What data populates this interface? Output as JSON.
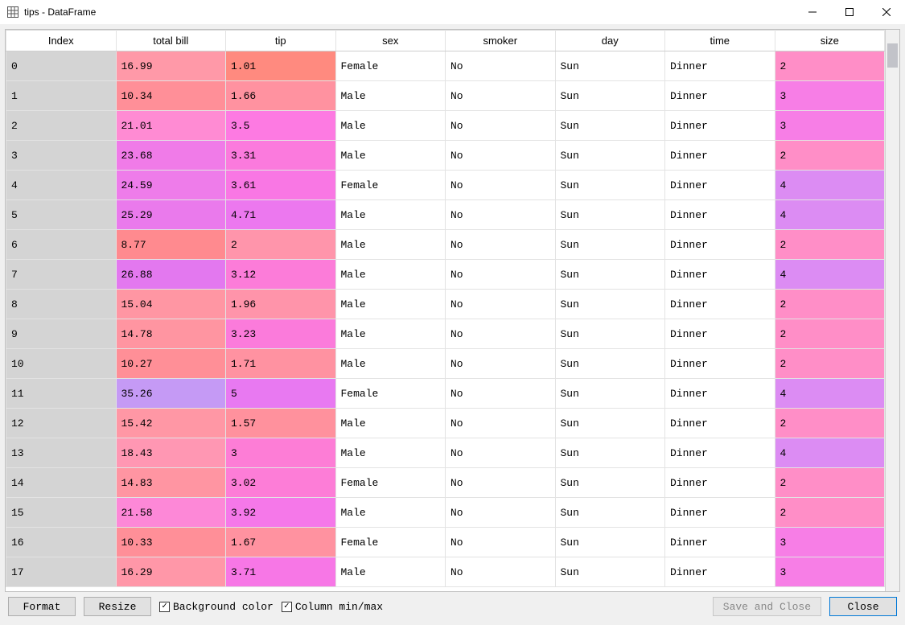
{
  "window": {
    "title": "tips - DataFrame"
  },
  "table": {
    "headers": [
      "Index",
      "total bill",
      "tip",
      "sex",
      "smoker",
      "day",
      "time",
      "size"
    ],
    "rows": [
      {
        "idx": "0",
        "total_bill": "16.99",
        "tip": "1.01",
        "sex": "Female",
        "smoker": "No",
        "day": "Sun",
        "time": "Dinner",
        "size": "2",
        "c_tb": "#ff99a8",
        "c_tip": "#ff8a7f",
        "c_size": "#ff8ec7"
      },
      {
        "idx": "1",
        "total_bill": "10.34",
        "tip": "1.66",
        "sex": "Male",
        "smoker": "No",
        "day": "Sun",
        "time": "Dinner",
        "size": "3",
        "c_tb": "#ff8f98",
        "c_tip": "#ff92a0",
        "c_size": "#f77ee6"
      },
      {
        "idx": "2",
        "total_bill": "21.01",
        "tip": "3.5",
        "sex": "Male",
        "smoker": "No",
        "day": "Sun",
        "time": "Dinner",
        "size": "3",
        "c_tb": "#ff8bd3",
        "c_tip": "#fd7ae2",
        "c_size": "#f77ee6"
      },
      {
        "idx": "3",
        "total_bill": "23.68",
        "tip": "3.31",
        "sex": "Male",
        "smoker": "No",
        "day": "Sun",
        "time": "Dinner",
        "size": "2",
        "c_tb": "#f07be8",
        "c_tip": "#fb7add",
        "c_size": "#ff8ec7"
      },
      {
        "idx": "4",
        "total_bill": "24.59",
        "tip": "3.61",
        "sex": "Female",
        "smoker": "No",
        "day": "Sun",
        "time": "Dinner",
        "size": "4",
        "c_tb": "#ee7cea",
        "c_tip": "#f977e4",
        "c_size": "#dc8cf3"
      },
      {
        "idx": "5",
        "total_bill": "25.29",
        "tip": "4.71",
        "sex": "Male",
        "smoker": "No",
        "day": "Sun",
        "time": "Dinner",
        "size": "4",
        "c_tb": "#ea7aec",
        "c_tip": "#ec78ef",
        "c_size": "#dc8cf3"
      },
      {
        "idx": "6",
        "total_bill": "8.77",
        "tip": "2",
        "sex": "Male",
        "smoker": "No",
        "day": "Sun",
        "time": "Dinner",
        "size": "2",
        "c_tb": "#ff8a8f",
        "c_tip": "#ff95ab",
        "c_size": "#ff8ec7"
      },
      {
        "idx": "7",
        "total_bill": "26.88",
        "tip": "3.12",
        "sex": "Male",
        "smoker": "No",
        "day": "Sun",
        "time": "Dinner",
        "size": "4",
        "c_tb": "#e378ef",
        "c_tip": "#fc7cd9",
        "c_size": "#dc8cf3"
      },
      {
        "idx": "8",
        "total_bill": "15.04",
        "tip": "1.96",
        "sex": "Male",
        "smoker": "No",
        "day": "Sun",
        "time": "Dinner",
        "size": "2",
        "c_tb": "#ff96a3",
        "c_tip": "#ff94aa",
        "c_size": "#ff8ec7"
      },
      {
        "idx": "9",
        "total_bill": "14.78",
        "tip": "3.23",
        "sex": "Male",
        "smoker": "No",
        "day": "Sun",
        "time": "Dinner",
        "size": "2",
        "c_tb": "#ff95a1",
        "c_tip": "#fb7bdb",
        "c_size": "#ff8ec7"
      },
      {
        "idx": "10",
        "total_bill": "10.27",
        "tip": "1.71",
        "sex": "Male",
        "smoker": "No",
        "day": "Sun",
        "time": "Dinner",
        "size": "2",
        "c_tb": "#ff8f97",
        "c_tip": "#ff92a1",
        "c_size": "#ff8ec7"
      },
      {
        "idx": "11",
        "total_bill": "35.26",
        "tip": "5",
        "sex": "Female",
        "smoker": "No",
        "day": "Sun",
        "time": "Dinner",
        "size": "4",
        "c_tb": "#c59af5",
        "c_tip": "#e879f1",
        "c_size": "#dc8cf3"
      },
      {
        "idx": "12",
        "total_bill": "15.42",
        "tip": "1.57",
        "sex": "Male",
        "smoker": "No",
        "day": "Sun",
        "time": "Dinner",
        "size": "2",
        "c_tb": "#ff97a5",
        "c_tip": "#ff919d",
        "c_size": "#ff8ec7"
      },
      {
        "idx": "13",
        "total_bill": "18.43",
        "tip": "3",
        "sex": "Male",
        "smoker": "No",
        "day": "Sun",
        "time": "Dinner",
        "size": "4",
        "c_tb": "#ff97b3",
        "c_tip": "#fd7dd6",
        "c_size": "#dc8cf3"
      },
      {
        "idx": "14",
        "total_bill": "14.83",
        "tip": "3.02",
        "sex": "Female",
        "smoker": "No",
        "day": "Sun",
        "time": "Dinner",
        "size": "2",
        "c_tb": "#ff95a2",
        "c_tip": "#fd7dd7",
        "c_size": "#ff8ec7"
      },
      {
        "idx": "15",
        "total_bill": "21.58",
        "tip": "3.92",
        "sex": "Male",
        "smoker": "No",
        "day": "Sun",
        "time": "Dinner",
        "size": "2",
        "c_tb": "#fd88d7",
        "c_tip": "#f578e9",
        "c_size": "#ff8ec7"
      },
      {
        "idx": "16",
        "total_bill": "10.33",
        "tip": "1.67",
        "sex": "Female",
        "smoker": "No",
        "day": "Sun",
        "time": "Dinner",
        "size": "3",
        "c_tb": "#ff8f98",
        "c_tip": "#ff92a0",
        "c_size": "#f77ee6"
      },
      {
        "idx": "17",
        "total_bill": "16.29",
        "tip": "3.71",
        "sex": "Male",
        "smoker": "No",
        "day": "Sun",
        "time": "Dinner",
        "size": "3",
        "c_tb": "#ff97a8",
        "c_tip": "#f777e6",
        "c_size": "#f77ee6"
      }
    ]
  },
  "footer": {
    "format_btn": "Format",
    "resize_btn": "Resize",
    "bg_color_label": "Background color",
    "bg_color_checked": true,
    "col_minmax_label": "Column min/max",
    "col_minmax_checked": true,
    "save_close_btn": "Save and Close",
    "close_btn": "Close"
  }
}
